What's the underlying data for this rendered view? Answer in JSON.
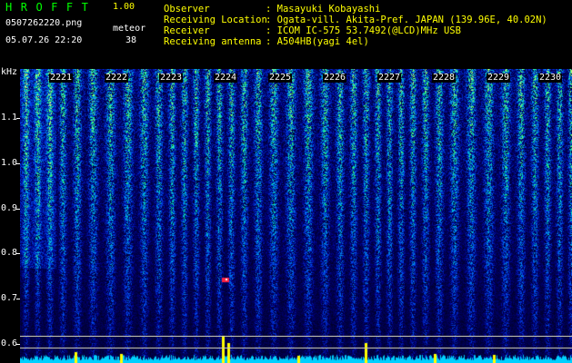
{
  "app": {
    "brand": "HROFFT",
    "version": "1.00",
    "filename": "0507262220.png",
    "datetime": "05.07.26 22:20",
    "meteor_label": "meteor",
    "meteor_count": "38"
  },
  "info": [
    {
      "label": "Observer",
      "value": ": Masayuki Kobayashi"
    },
    {
      "label": "Receiving Location",
      "value": ": Ogata-vill. Akita-Pref. JAPAN (139.96E, 40.02N)"
    },
    {
      "label": "Receiver",
      "value": ": ICOM IC-575 53.7492(@LCD)MHz USB"
    },
    {
      "label": "Receiving antenna",
      "value": ": A504HB(yagi 4el)"
    }
  ],
  "axis": {
    "unit": "kHz",
    "y_labels": [
      "1.1",
      "1.0",
      "0.9",
      "0.8",
      "0.7",
      "0.6"
    ]
  },
  "time_labels": [
    "2221",
    "2222",
    "2223",
    "2224",
    "2225",
    "2226",
    "2227",
    "2228",
    "2229",
    "2230"
  ],
  "colors": {
    "background": "#000000",
    "brand": "#00ff00",
    "header_text": "#ffff00",
    "spectrogram_base": "#00107a",
    "signal_peak": "#ffff00",
    "meteor_mark": "#ff2040",
    "baseline_fill": "#00d0ff"
  }
}
